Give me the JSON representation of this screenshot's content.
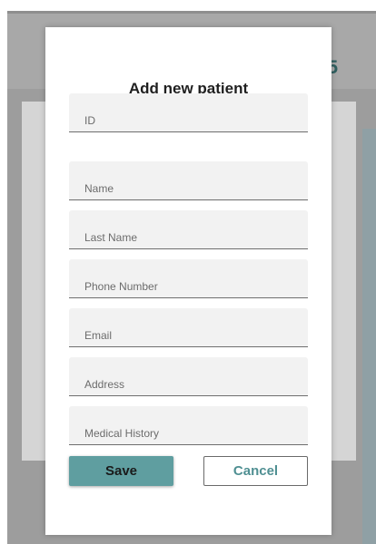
{
  "background": {
    "header_fragment": "5"
  },
  "modal": {
    "title": "Add new patient",
    "fields": [
      {
        "placeholder": "ID",
        "value": ""
      },
      {
        "placeholder": "Name",
        "value": ""
      },
      {
        "placeholder": "Last Name",
        "value": ""
      },
      {
        "placeholder": "Phone Number",
        "value": ""
      },
      {
        "placeholder": "Email",
        "value": ""
      },
      {
        "placeholder": "Address",
        "value": ""
      },
      {
        "placeholder": "Medical History",
        "value": ""
      }
    ],
    "save_label": "Save",
    "cancel_label": "Cancel"
  },
  "colors": {
    "accent": "#5f9ea0",
    "overlay": "#a8a8a8"
  }
}
